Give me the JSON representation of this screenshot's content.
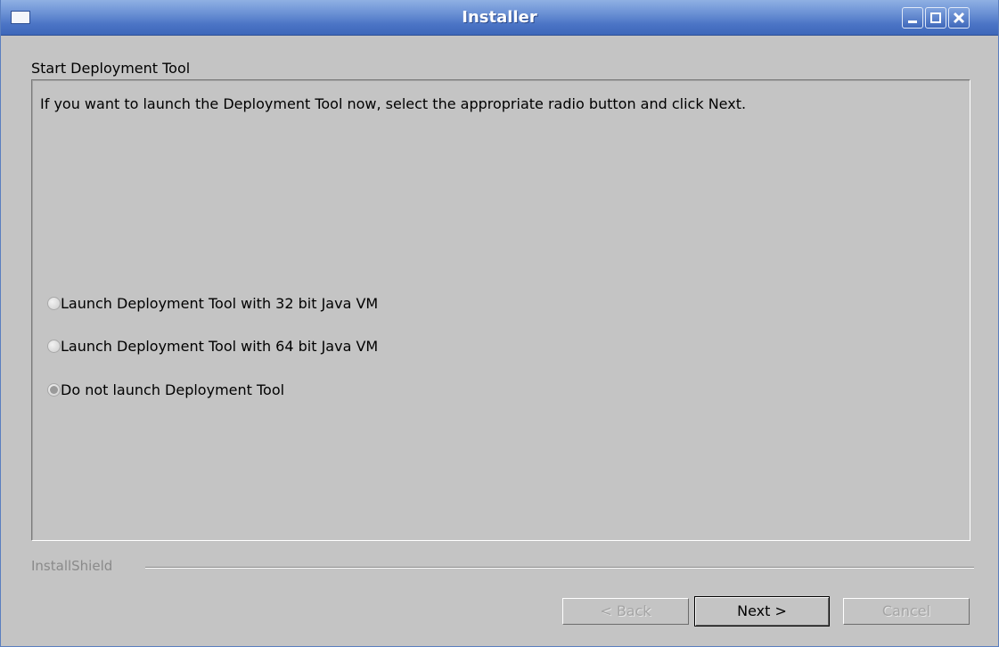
{
  "window": {
    "title": "Installer"
  },
  "titlebar": {
    "menu_icon": "window-icon",
    "controls": [
      "minimize-icon",
      "maximize-icon",
      "close-icon"
    ]
  },
  "page": {
    "heading": "Start Deployment Tool",
    "instructions": "If you want to launch the Deployment Tool now, select the appropriate radio button and click Next."
  },
  "options": [
    {
      "label": "Launch Deployment Tool with 32 bit Java VM",
      "selected": false
    },
    {
      "label": "Launch Deployment Tool with 64 bit Java VM",
      "selected": false
    },
    {
      "label": "Do not launch Deployment Tool",
      "selected": true
    }
  ],
  "footer": {
    "brand": "InstallShield"
  },
  "buttons": {
    "back_label": "< Back",
    "next_label": "Next >",
    "cancel_label": "Cancel"
  },
  "colors": {
    "titlebar": "#4b74c5",
    "background": "#c4c4c4"
  }
}
